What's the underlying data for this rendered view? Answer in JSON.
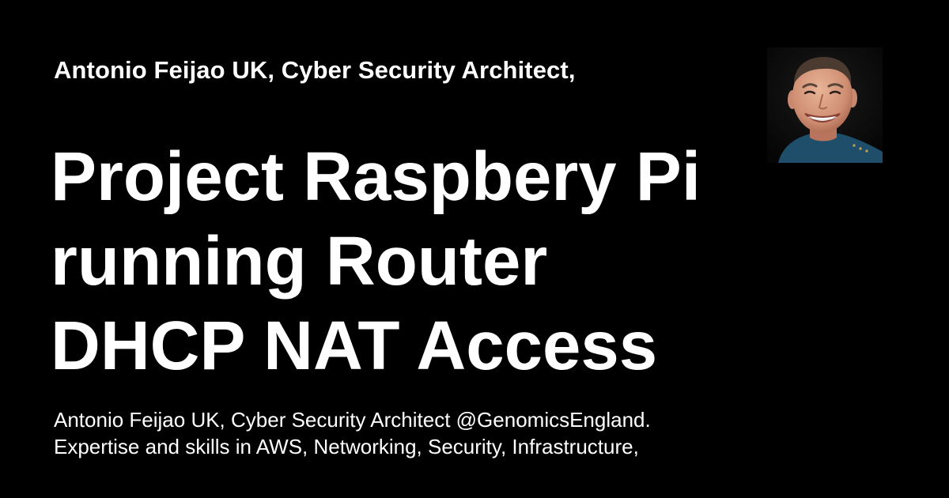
{
  "card": {
    "site_name": "Antonio Feijao UK, Cyber Security Architect,",
    "title_lines": [
      "Project Raspbery Pi",
      "running Router",
      "DHCP NAT Access"
    ],
    "description_lines": [
      "Antonio Feijao UK, Cyber Security Architect @GenomicsEngland.",
      "Expertise and skills in AWS, Networking, Security, Infrastructure,"
    ],
    "avatar_icon": "author-photo",
    "colors": {
      "background": "#000000",
      "text": "#ffffff",
      "shirt": "#1f4e6b"
    }
  }
}
